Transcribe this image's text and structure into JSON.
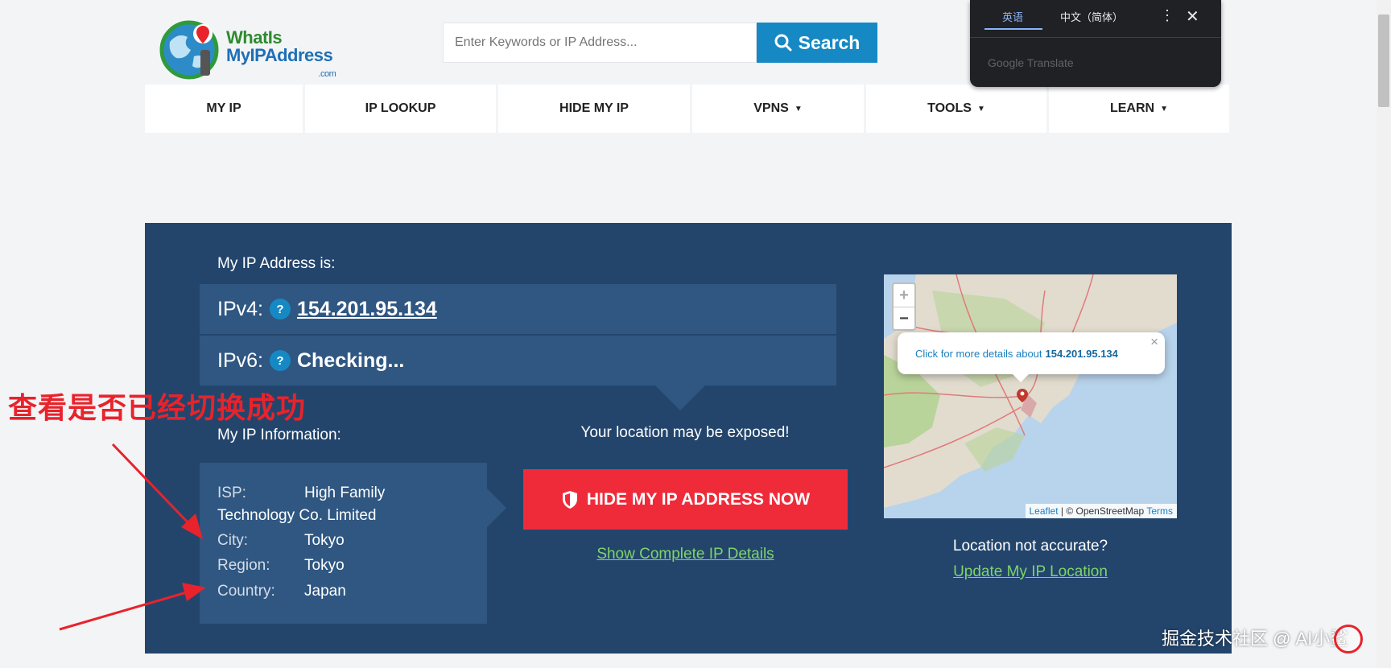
{
  "logo": {
    "line1": "WhatIs",
    "line2": "MyIPAddress",
    "suffix": ".com"
  },
  "search": {
    "placeholder": "Enter Keywords or IP Address...",
    "button_label": "Search"
  },
  "nav": {
    "items": [
      {
        "label": "MY IP",
        "caret": ""
      },
      {
        "label": "IP LOOKUP",
        "caret": ""
      },
      {
        "label": "HIDE MY IP",
        "caret": ""
      },
      {
        "label": "VPNS",
        "caret": "▼"
      },
      {
        "label": "TOOLS",
        "caret": "▼"
      },
      {
        "label": "LEARN",
        "caret": "▼"
      }
    ]
  },
  "translate": {
    "tab_active": "英语",
    "tab_other": "中文（简体）",
    "brand": "Google Translate",
    "more": "⋮",
    "close": "✕"
  },
  "ip": {
    "heading": "My IP Address is:",
    "v4_label": "IPv4:",
    "v4_value": "154.201.95.134",
    "v6_label": "IPv6:",
    "v6_value": "Checking...",
    "help": "?"
  },
  "info": {
    "heading": "My IP Information:",
    "isp_label": "ISP:",
    "isp_value_1": "High Family",
    "isp_value_2": "Technology Co. Limited",
    "city_label": "City:",
    "city_value": "Tokyo",
    "region_label": "Region:",
    "region_value": "Tokyo",
    "country_label": "Country:",
    "country_value": "Japan"
  },
  "exposure": {
    "warning": "Your location may be exposed!",
    "hide_button": "HIDE MY IP ADDRESS NOW",
    "details_link": "Show Complete IP Details"
  },
  "map": {
    "zoom_in": "+",
    "zoom_out": "−",
    "popup_text": "Click for more details about",
    "popup_ip": "154.201.95.134",
    "popup_close": "×",
    "attr_leaflet": "Leaflet",
    "attr_sep": " | © OpenStreetMap ",
    "attr_terms": "Terms"
  },
  "location": {
    "question": "Location not accurate?",
    "update_link": "Update My IP Location"
  },
  "annotation": {
    "text": "查看是否已经切换成功",
    "color": "#e8232c"
  },
  "watermark": {
    "text": "掘金技术社区 @ AI小鲨"
  },
  "colors": {
    "panel": "#23456c",
    "row": "#2f5782",
    "accent": "#1689c4",
    "danger": "#ef2b3a",
    "link": "#7ed46a"
  }
}
